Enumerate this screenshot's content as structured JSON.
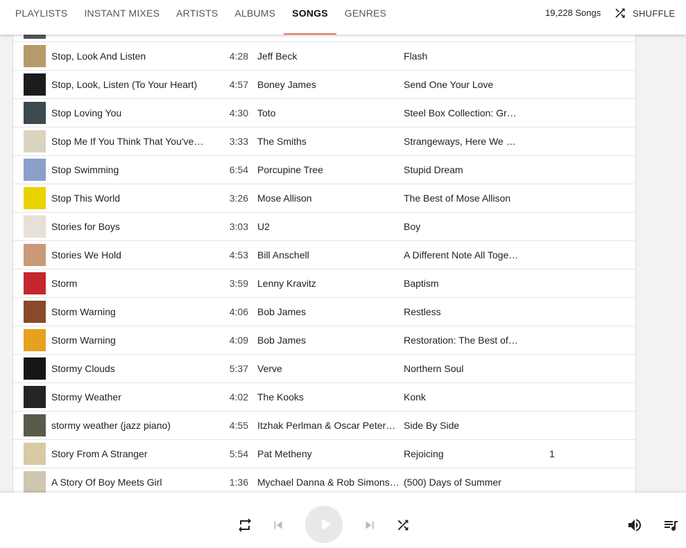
{
  "tabs": [
    {
      "label": "PLAYLISTS"
    },
    {
      "label": "INSTANT MIXES"
    },
    {
      "label": "ARTISTS"
    },
    {
      "label": "ALBUMS"
    },
    {
      "label": "SONGS"
    },
    {
      "label": "GENRES"
    }
  ],
  "active_tab": "SONGS",
  "header": {
    "song_count": "19,228 Songs",
    "shuffle_label": "SHUFFLE"
  },
  "songs": [
    {
      "title": "Stop, Look And Listen",
      "duration": "4:28",
      "artist": "Jeff Beck",
      "album": "Flash",
      "number": "",
      "art_color": "#b59a6a"
    },
    {
      "title": "Stop, Look, Listen (To Your Heart)",
      "duration": "4:57",
      "artist": "Boney James",
      "album": "Send One Your Love",
      "number": "",
      "art_color": "#1c1c1c"
    },
    {
      "title": "Stop Loving You",
      "duration": "4:30",
      "artist": "Toto",
      "album": "Steel Box Collection: Greatest Hits",
      "number": "",
      "art_color": "#3b4a4f"
    },
    {
      "title": "Stop Me If You Think That You've Heard This One Before",
      "duration": "3:33",
      "artist": "The Smiths",
      "album": "Strangeways, Here We Come",
      "number": "",
      "art_color": "#d9d3bf"
    },
    {
      "title": "Stop Swimming",
      "duration": "6:54",
      "artist": "Porcupine Tree",
      "album": "Stupid Dream",
      "number": "",
      "art_color": "#8aa0c8"
    },
    {
      "title": "Stop This World",
      "duration": "3:26",
      "artist": "Mose Allison",
      "album": "The Best of Mose Allison",
      "number": "",
      "art_color": "#e8d300"
    },
    {
      "title": "Stories for Boys",
      "duration": "3:03",
      "artist": "U2",
      "album": "Boy",
      "number": "",
      "art_color": "#e6e0d8"
    },
    {
      "title": "Stories We Hold",
      "duration": "4:53",
      "artist": "Bill Anschell",
      "album": "A Different Note All Together",
      "number": "",
      "art_color": "#c89a7a"
    },
    {
      "title": "Storm",
      "duration": "3:59",
      "artist": "Lenny Kravitz",
      "album": "Baptism",
      "number": "",
      "art_color": "#c4262d"
    },
    {
      "title": "Storm Warning",
      "duration": "4:06",
      "artist": "Bob James",
      "album": "Restless",
      "number": "",
      "art_color": "#8a4a2a"
    },
    {
      "title": "Storm Warning",
      "duration": "4:09",
      "artist": "Bob James",
      "album": "Restoration: The Best of Bob James",
      "number": "",
      "art_color": "#e8a020"
    },
    {
      "title": "Stormy Clouds",
      "duration": "5:37",
      "artist": "Verve",
      "album": "Northern Soul",
      "number": "",
      "art_color": "#151515"
    },
    {
      "title": "Stormy Weather",
      "duration": "4:02",
      "artist": "The Kooks",
      "album": "Konk",
      "number": "",
      "art_color": "#242424"
    },
    {
      "title": "stormy weather (jazz piano)",
      "duration": "4:55",
      "artist": "Itzhak Perlman & Oscar Peterson",
      "album": "Side By Side",
      "number": "",
      "art_color": "#5a5a4a"
    },
    {
      "title": "Story From A Stranger",
      "duration": "5:54",
      "artist": "Pat Metheny",
      "album": "Rejoicing",
      "number": "1",
      "art_color": "#d8caa4"
    },
    {
      "title": "A Story Of Boy Meets Girl",
      "duration": "1:36",
      "artist": "Mychael Danna & Rob Simonsen",
      "album": "(500) Days of Summer",
      "number": "",
      "art_color": "#cfc7b0"
    }
  ],
  "colors": {
    "accent": "#e9735a",
    "row_border": "#e4e4e4",
    "icon": "#222222",
    "icon_disabled": "#bbbbbb",
    "play_bg": "#e8e8e8"
  },
  "player": {
    "icons": [
      "repeat-icon",
      "skip-previous-icon",
      "play-icon",
      "skip-next-icon",
      "shuffle-icon",
      "volume-icon",
      "queue-icon"
    ]
  }
}
